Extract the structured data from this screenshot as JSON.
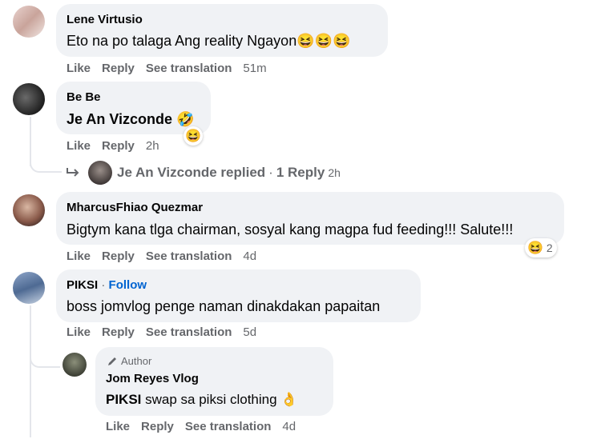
{
  "comments": [
    {
      "author": "Lene Virtusio",
      "text": "Eto na po talaga Ang reality Ngayon",
      "emoji": "😆😆😆",
      "actions": {
        "like": "Like",
        "reply": "Reply",
        "translate": "See translation",
        "time": "51m"
      }
    },
    {
      "author": "Be Be",
      "text": "Je An Vizconde",
      "emoji": "🤣",
      "actions": {
        "like": "Like",
        "reply": "Reply",
        "time": "2h"
      },
      "reaction_emoji": "😆",
      "replies_summary": {
        "name": "Je An Vizconde replied",
        "sep": "·",
        "count": "1 Reply",
        "time": "2h"
      }
    },
    {
      "author": "MharcusFhiao Quezmar",
      "text": "Bigtym kana tlga chairman, sosyal kang magpa fud feeding!!! Salute!!!",
      "actions": {
        "like": "Like",
        "reply": "Reply",
        "translate": "See translation",
        "time": "4d"
      },
      "reaction_emoji": "😆",
      "reaction_count": "2"
    },
    {
      "author": "PIKSI",
      "follow_sep": "·",
      "follow": "Follow",
      "text": "boss jomvlog penge naman dinakdakan papaitan",
      "actions": {
        "like": "Like",
        "reply": "Reply",
        "translate": "See translation",
        "time": "5d"
      }
    }
  ],
  "reply": {
    "badge": "Author",
    "author": "Jom Reyes Vlog",
    "mention": "PIKSI",
    "text": "swap sa piksi clothing",
    "emoji": "👌",
    "actions": {
      "like": "Like",
      "reply": "Reply",
      "translate": "See translation",
      "time": "4d"
    }
  },
  "icons": {
    "reply_arrow": "reply-arrow-icon",
    "pen": "pen-icon"
  }
}
